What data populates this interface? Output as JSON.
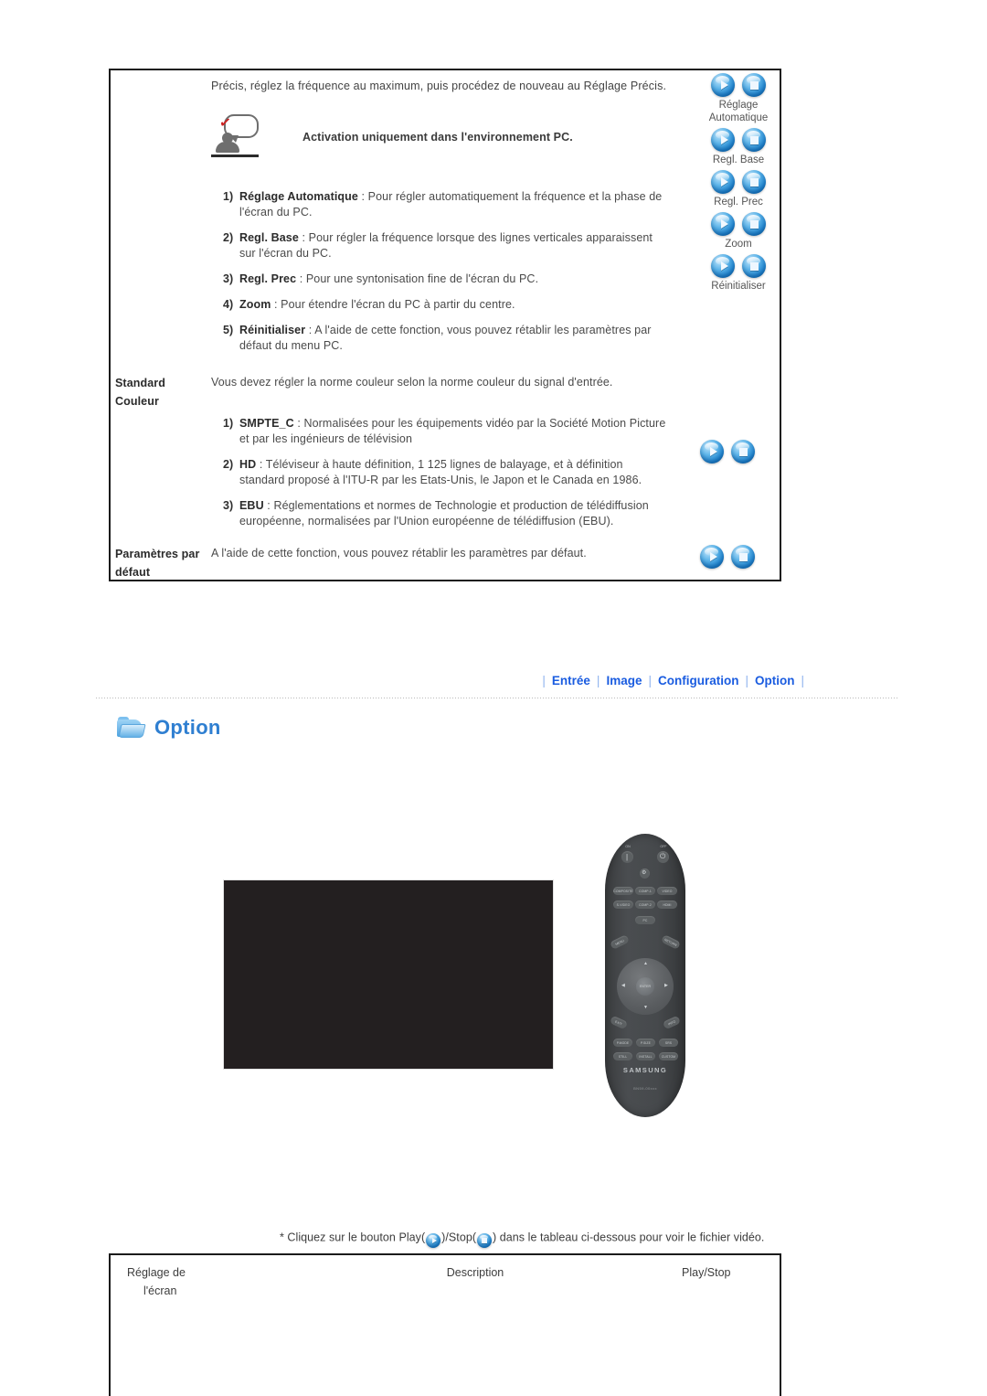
{
  "top_panel": {
    "intro_line": "Précis, réglez la fréquence au maximum, puis procédez de nouveau au Réglage Précis.",
    "note": {
      "icon": "speech-bubble-check-person-icon",
      "text": "Activation uniquement dans l'environnement PC."
    },
    "numbered_items": [
      {
        "marker": "1)",
        "term": "Réglage Automatique",
        "sep": ":",
        "line1": "Pour régler automatiquement la fréquence et la phase de",
        "line2": "l'écran du PC."
      },
      {
        "marker": "2)",
        "term": "Regl. Base",
        "sep": ":",
        "line1": "Pour régler la fréquence lorsque des lignes verticales apparaissent",
        "line2": "sur l'écran du PC."
      },
      {
        "marker": "3)",
        "term": "Regl. Prec",
        "sep": ":",
        "line1": "Pour une syntonisation fine de l'écran du PC.",
        "line2": ""
      },
      {
        "marker": "4)",
        "term": "Zoom",
        "sep": ":",
        "line1": "Pour étendre l'écran du PC à partir du centre.",
        "line2": ""
      },
      {
        "marker": "5)",
        "term": "Réinitialiser",
        "sep": ":",
        "line1": "A l'aide de cette fonction, vous pouvez rétablir les paramètres par",
        "line2": "défaut du menu PC."
      }
    ],
    "button_column": [
      {
        "caption": "Réglage",
        "caption2": "Automatique"
      },
      {
        "caption": "Regl. Base"
      },
      {
        "caption": "Regl. Prec"
      },
      {
        "caption": "Zoom"
      },
      {
        "caption": "Réinitialiser"
      }
    ],
    "rows": [
      {
        "label_line1": "Standard",
        "label_line2": "Couleur",
        "body": "Vous devez régler la norme couleur selon la norme couleur du signal d'entrée.",
        "sub_items": [
          {
            "marker": "1)",
            "term": "SMPTE_C",
            "sep": ":",
            "line1": "Normalisées pour les équipements vidéo par la Société Motion Picture",
            "line2": "et par les ingénieurs de télévision"
          },
          {
            "marker": "2)",
            "term": "HD",
            "sep": ":",
            "line1": "Téléviseur à haute définition, 1 125 lignes de balayage, et à définition",
            "line2": "standard proposé à l'ITU-R par les Etats-Unis, le Japon et le Canada en 1986."
          },
          {
            "marker": "3)",
            "term": "EBU",
            "sep": ":",
            "line1": "Réglementations et normes de Technologie et production de télédiffusion",
            "line2": "européenne, normalisées par l'Union européenne de télédiffusion (EBU)."
          }
        ]
      },
      {
        "label_line1": "Paramètres par",
        "label_line2": "défaut",
        "body": "A l'aide de cette fonction, vous pouvez rétablir les paramètres par défaut.",
        "sub_items": []
      }
    ]
  },
  "nav": {
    "items": [
      "Entrée",
      "Image",
      "Configuration",
      "Option"
    ],
    "separator": "|",
    "color": "#1a5ce0"
  },
  "section": {
    "icon": "folder-icon",
    "title": "Option"
  },
  "media": {
    "screen_placeholder": "",
    "remote": {
      "brand": "SAMSUNG",
      "model": "BN59-00xxx",
      "power_on_label": "ON",
      "power_off_label": "OFF",
      "source_buttons_row1": [
        "COMPOSITE",
        "COMP-1",
        "VIDEO"
      ],
      "source_buttons_row2": [
        "S-VIDEO",
        "COMP-2",
        "HDMI"
      ],
      "pc_button": "PC",
      "menu_button": "MENU",
      "return_button": "RETURN",
      "enter_label": "ENTER",
      "exit_button": "EXIT",
      "info_button": "INFO",
      "function_row1": [
        "P.MODE",
        "P.SIZE",
        "SRS"
      ],
      "function_row2": [
        "STILL",
        "INSTALL",
        "CUSTOM"
      ]
    }
  },
  "footnote": {
    "prefix": "* Cliquez sur le bouton Play(",
    "middle": ")/Stop(",
    "suffix": ") dans le tableau ci-dessous pour voir le fichier vidéo."
  },
  "bottom_table": {
    "headers": {
      "screen_line1": "Réglage de",
      "screen_line2": "l'écran",
      "description": "Description",
      "play_stop": "Play/Stop"
    },
    "rows": []
  }
}
